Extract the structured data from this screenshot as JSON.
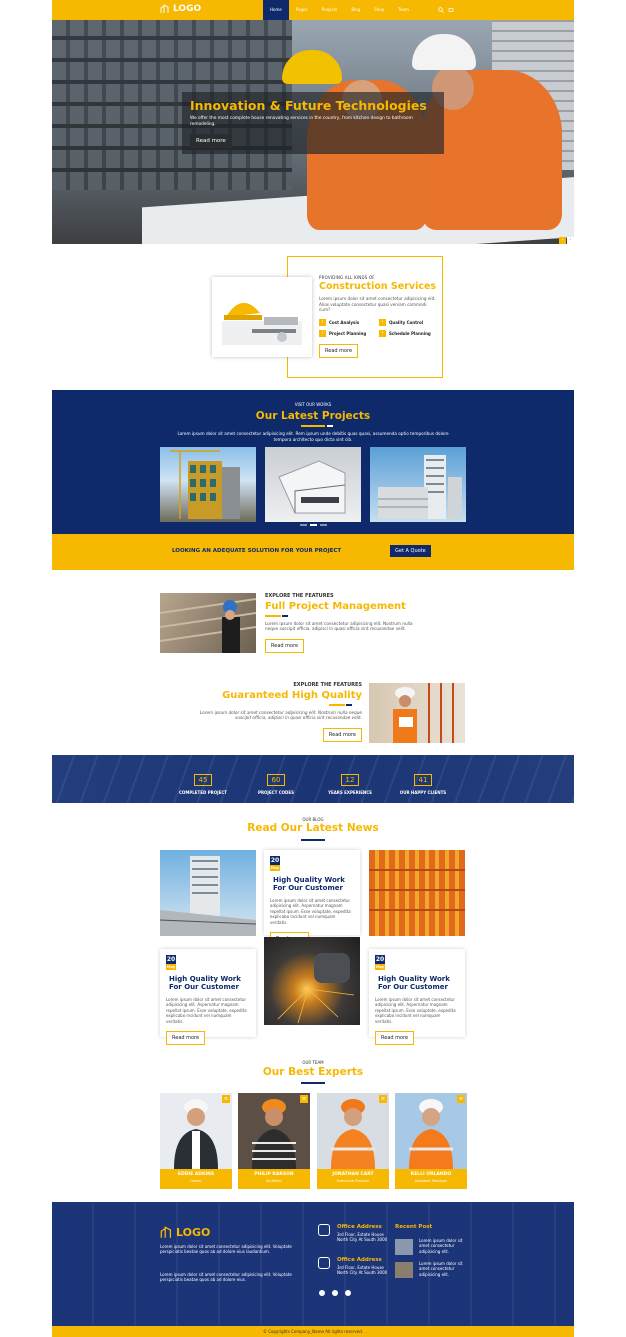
{
  "nav": {
    "logo": "LOGO",
    "items": [
      "Home",
      "Pages",
      "Projects",
      "Blog",
      "Shop",
      "Team"
    ]
  },
  "hero": {
    "title": "Innovation & Future Technologies",
    "text": "We offer the most complete house renovating services in the country, from kitchen design to bathroom remodeling.",
    "button": "Read more"
  },
  "services": {
    "caption": "PROVIDING ALL KINDS OF",
    "title": "Construction Services",
    "text": "Lorem ipsum dolor sit amet consectetur adipisicing elit. Alias voluptate consectetur quasi veniam commodi cum?",
    "items": [
      "Cost Analysis",
      "Quality Control",
      "Project Planning",
      "Schedule Planning"
    ],
    "button": "Read more"
  },
  "projects": {
    "caption": "VISIT OUR WORKS",
    "title": "Our Latest Projects",
    "text": "Lorem ipsum dolor sit amet consectetur adipisicing elit. Rem ipsum unde debitis quas quasi, assumenda optio temporibus dolore tempora architecto quo dicta sint cib."
  },
  "quote": {
    "text": "LOOKING AN ADEQUATE SOLUTION FOR YOUR PROJECT",
    "button": "Get A Quote"
  },
  "feature1": {
    "caption": "EXPLORE THE FEATURES",
    "title": "Full Project Management",
    "text": "Lorem ipsum dolor sit amet consectetur adipisicing elit. Nostrum nulla neque suscipit officia, adipisci in quasi officia sint recusandae velit.",
    "button": "Read more"
  },
  "feature2": {
    "caption": "EXPLORE THE FEATURES",
    "title": "Guaranteed High Quality",
    "text": "Lorem ipsum dolor sit amet consectetur adipisicing elit. Nostrum nulla neque suscipit officia, adipisci in quasi officia sint recusandae velit.",
    "button": "Read more"
  },
  "counters": [
    {
      "num": "45",
      "label": "COMPLETED PROJECT"
    },
    {
      "num": "60",
      "label": "PROJECT CODES"
    },
    {
      "num": "12",
      "label": "YEARS EXPERIENCE"
    },
    {
      "num": "41",
      "label": "OUR HAPPY CLIENTS"
    }
  ],
  "blog": {
    "caption": "OUR BLOG",
    "title": "Read Our Latest News",
    "cards": [
      {
        "day": "20",
        "mon": "May",
        "title": "High Quality Work For Our Customer",
        "text": "Lorem ipsum dolor sit amet consectetur adipisicing elit. Aspernatur magnam repellat ipsum. Esse voluptate, expedita explicabo incidunt vel numquam veritatis.",
        "button": "Read more"
      },
      {
        "day": "20",
        "mon": "May",
        "title": "High Quality Work For Our Customer",
        "text": "Lorem ipsum dolor sit amet consectetur adipisicing elit. Aspernatur magnam repellat ipsum. Esse voluptate, expedita explicabo incidunt vel numquam veritatis.",
        "button": "Read more"
      },
      {
        "day": "20",
        "mon": "May",
        "title": "High Quality Work For Our Customer",
        "text": "Lorem ipsum dolor sit amet consectetur adipisicing elit. Aspernatur magnam repellat ipsum. Esse voluptate, expedita explicabo incidunt vel numquam veritatis.",
        "button": "Read more"
      }
    ]
  },
  "team": {
    "caption": "OUR TEAM",
    "title": "Our Best Experts",
    "members": [
      {
        "name": "EDDIE ADKINS",
        "role": "Owner"
      },
      {
        "name": "PHILIP KARSON",
        "role": "Architect"
      },
      {
        "name": "JONATHAN CART",
        "role": "Executive Director"
      },
      {
        "name": "KELLI ORLANDO",
        "role": "Assistant Manager"
      }
    ]
  },
  "footer": {
    "logo": "LOGO",
    "text1": "Lorem ipsum dolor sit amet consectetur adipisicing elit. Voluptate perspiciatis beatae quos ab ad dolore eius laudantium.",
    "text2": "Lorem ipsum dolor sit amet consectetur adipisicing elit. Voluptate perspiciatis beatae quos ab ad dolore eius.",
    "office_title": "Office Address",
    "office_text": "3rd Floor, Estate House North City At South 3000",
    "office2_title": "Office Address",
    "office2_text": "3rd Floor, Estate House North City At South 3000",
    "recent_title": "Recent Post",
    "recent1": "Lorem ipsum dolor sit amet consectetur adipisicing elit.",
    "recent2": "Lorem ipsum dolor sit amet consectetur adipisicing elit.",
    "copyright": "© Copyrights Company_Name All rights reserved."
  },
  "colors": {
    "accent": "#f6b800",
    "navy": "#0e2a6b"
  }
}
